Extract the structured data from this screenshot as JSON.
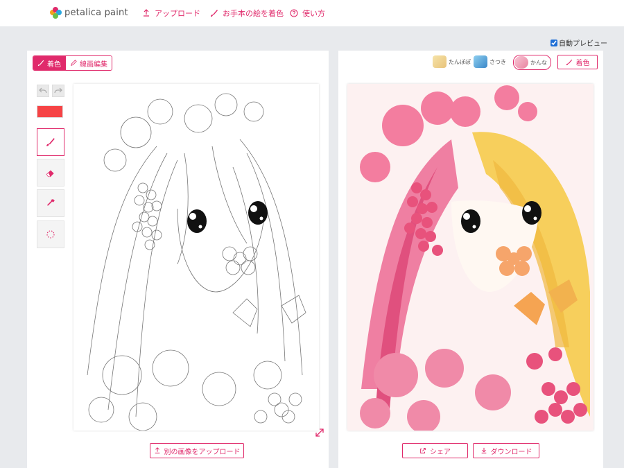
{
  "header": {
    "logo_text": "petalica paint",
    "nav": [
      {
        "label": "アップロード",
        "icon": "upload-icon"
      },
      {
        "label": "お手本の絵を着色",
        "icon": "brush-icon"
      },
      {
        "label": "使い方",
        "icon": "help-circle-icon"
      }
    ]
  },
  "preview": {
    "auto_preview_label": "自動プレビュー",
    "auto_preview_checked": true
  },
  "left_panel": {
    "mode_tabs": [
      {
        "label": "着色",
        "icon": "brush-icon",
        "active": true
      },
      {
        "label": "線画編集",
        "icon": "pencil-icon",
        "active": false
      }
    ],
    "tools": [
      {
        "name": "brush-tool",
        "icon": "brush-icon",
        "active": true
      },
      {
        "name": "eraser-tool",
        "icon": "eraser-icon",
        "active": false
      },
      {
        "name": "eyedropper-tool",
        "icon": "eyedropper-icon",
        "active": false
      },
      {
        "name": "lasso-tool",
        "icon": "dotted-circle-icon",
        "active": false
      }
    ],
    "current_color": "#f64345",
    "upload_other_label": "別の画像をアップロード"
  },
  "right_panel": {
    "styles": [
      {
        "label": "たんぽぽ",
        "selected": false
      },
      {
        "label": "さつき",
        "selected": false
      },
      {
        "label": "かんな",
        "selected": true
      }
    ],
    "colorize_button_label": "着色",
    "share_label": "シェア",
    "download_label": "ダウンロード"
  },
  "colors": {
    "accent": "#e02a6b",
    "background": "#e8eaed"
  }
}
